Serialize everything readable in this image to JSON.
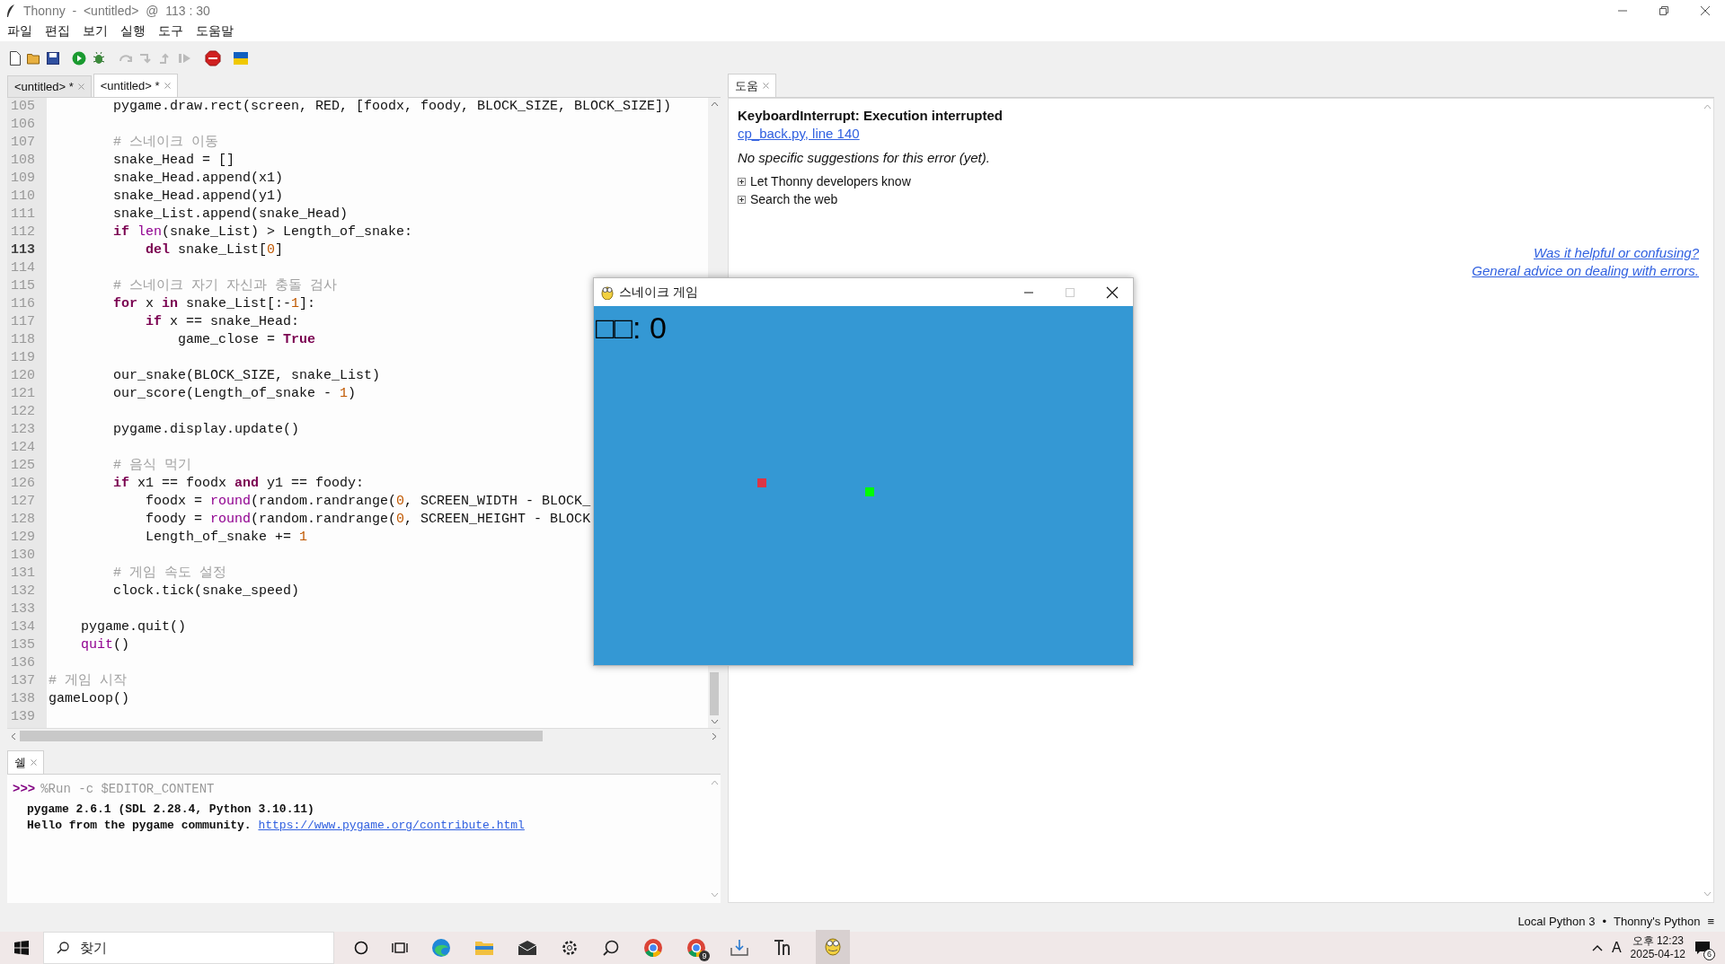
{
  "window": {
    "title": "Thonny  -  <untitled>  @  113 : 30"
  },
  "menu": [
    "파일",
    "편집",
    "보기",
    "실행",
    "도구",
    "도움말"
  ],
  "editor_tabs": [
    {
      "label": "<untitled> *",
      "selected": false
    },
    {
      "label": "<untitled> *",
      "selected": true
    }
  ],
  "editor": {
    "lines": [
      {
        "number": "105",
        "current": false,
        "tokens": [
          {
            "kind": "plain",
            "text": "        pygame.draw.rect(screen, RED, [foodx, foody, BLOCK_SIZE, BLOCK_SIZE])"
          }
        ]
      },
      {
        "number": "106",
        "current": false
      },
      {
        "number": "107",
        "current": false,
        "tokens": [
          {
            "kind": "comment",
            "text": "        # 스네이크 이동"
          }
        ]
      },
      {
        "number": "108",
        "current": false,
        "tokens": [
          {
            "kind": "plain",
            "text": "        snake_Head = []"
          }
        ]
      },
      {
        "number": "109",
        "current": false,
        "tokens": [
          {
            "kind": "plain",
            "text": "        snake_Head.append(x1)"
          }
        ]
      },
      {
        "number": "110",
        "current": false,
        "tokens": [
          {
            "kind": "plain",
            "text": "        snake_Head.append(y1)"
          }
        ]
      },
      {
        "number": "111",
        "current": false,
        "tokens": [
          {
            "kind": "plain",
            "text": "        snake_List.append(snake_Head)"
          }
        ]
      },
      {
        "number": "112",
        "current": false,
        "tokens": [
          {
            "kind": "keyword",
            "text": "        if "
          },
          {
            "kind": "builtin",
            "text": "len"
          },
          {
            "kind": "plain",
            "text": "(snake_List) > Length_of_snake:"
          }
        ]
      },
      {
        "number": "113",
        "current": true,
        "tokens": [
          {
            "kind": "keyword",
            "text": "            del"
          },
          {
            "kind": "plain",
            "text": " snake_List["
          },
          {
            "kind": "number",
            "text": "0"
          },
          {
            "kind": "plain",
            "text": "]"
          }
        ]
      },
      {
        "number": "114",
        "current": false
      },
      {
        "number": "115",
        "current": false,
        "tokens": [
          {
            "kind": "comment",
            "text": "        # 스네이크 자기 자신과 충돌 검사"
          }
        ]
      },
      {
        "number": "116",
        "current": false,
        "tokens": [
          {
            "kind": "keyword",
            "text": "        for"
          },
          {
            "kind": "plain",
            "text": " x "
          },
          {
            "kind": "keyword",
            "text": "in"
          },
          {
            "kind": "plain",
            "text": " snake_List[:-"
          },
          {
            "kind": "number",
            "text": "1"
          },
          {
            "kind": "plain",
            "text": "]:"
          }
        ]
      },
      {
        "number": "117",
        "current": false,
        "tokens": [
          {
            "kind": "keyword",
            "text": "            if"
          },
          {
            "kind": "plain",
            "text": " x == snake_Head:"
          }
        ]
      },
      {
        "number": "118",
        "current": false,
        "tokens": [
          {
            "kind": "plain",
            "text": "                game_close = "
          },
          {
            "kind": "keyword",
            "text": "True"
          }
        ]
      },
      {
        "number": "119",
        "current": false
      },
      {
        "number": "120",
        "current": false,
        "tokens": [
          {
            "kind": "plain",
            "text": "        our_snake(BLOCK_SIZE, snake_List)"
          }
        ]
      },
      {
        "number": "121",
        "current": false,
        "tokens": [
          {
            "kind": "plain",
            "text": "        our_score(Length_of_snake - "
          },
          {
            "kind": "number",
            "text": "1"
          },
          {
            "kind": "plain",
            "text": ")"
          }
        ]
      },
      {
        "number": "122",
        "current": false
      },
      {
        "number": "123",
        "current": false,
        "tokens": [
          {
            "kind": "plain",
            "text": "        pygame.display.update()"
          }
        ]
      },
      {
        "number": "124",
        "current": false
      },
      {
        "number": "125",
        "current": false,
        "tokens": [
          {
            "kind": "comment",
            "text": "        # 음식 먹기"
          }
        ]
      },
      {
        "number": "126",
        "current": false,
        "tokens": [
          {
            "kind": "keyword",
            "text": "        if"
          },
          {
            "kind": "plain",
            "text": " x1 == foodx "
          },
          {
            "kind": "keyword",
            "text": "and"
          },
          {
            "kind": "plain",
            "text": " y1 == foody:"
          }
        ]
      },
      {
        "number": "127",
        "current": false,
        "tokens": [
          {
            "kind": "plain",
            "text": "            foodx = "
          },
          {
            "kind": "builtin",
            "text": "round"
          },
          {
            "kind": "plain",
            "text": "(random.randrange("
          },
          {
            "kind": "number",
            "text": "0"
          },
          {
            "kind": "plain",
            "text": ", SCREEN_WIDTH - BLOCK_"
          }
        ]
      },
      {
        "number": "128",
        "current": false,
        "tokens": [
          {
            "kind": "plain",
            "text": "            foody = "
          },
          {
            "kind": "builtin",
            "text": "round"
          },
          {
            "kind": "plain",
            "text": "(random.randrange("
          },
          {
            "kind": "number",
            "text": "0"
          },
          {
            "kind": "plain",
            "text": ", SCREEN_HEIGHT - BLOCK"
          }
        ]
      },
      {
        "number": "129",
        "current": false,
        "tokens": [
          {
            "kind": "plain",
            "text": "            Length_of_snake += "
          },
          {
            "kind": "number",
            "text": "1"
          }
        ]
      },
      {
        "number": "130",
        "current": false
      },
      {
        "number": "131",
        "current": false,
        "tokens": [
          {
            "kind": "comment",
            "text": "        # 게임 속도 설정"
          }
        ]
      },
      {
        "number": "132",
        "current": false,
        "tokens": [
          {
            "kind": "plain",
            "text": "        clock.tick(snake_speed)"
          }
        ]
      },
      {
        "number": "133",
        "current": false
      },
      {
        "number": "134",
        "current": false,
        "tokens": [
          {
            "kind": "plain",
            "text": "    pygame.quit()"
          }
        ]
      },
      {
        "number": "135",
        "current": false,
        "tokens": [
          {
            "kind": "builtin",
            "text": "    quit"
          },
          {
            "kind": "plain",
            "text": "()"
          }
        ]
      },
      {
        "number": "136",
        "current": false
      },
      {
        "number": "137",
        "current": false,
        "tokens": [
          {
            "kind": "comment",
            "text": "# 게임 시작"
          }
        ]
      },
      {
        "number": "138",
        "current": false,
        "tokens": [
          {
            "kind": "plain",
            "text": "gameLoop()"
          }
        ]
      },
      {
        "number": "139",
        "current": false
      }
    ]
  },
  "shell": {
    "tab": "쉘",
    "prompt": ">>>",
    "command": "%Run -c $EDITOR_CONTENT",
    "output": [
      "pygame 2.6.1 (SDL 2.28.4, Python 3.10.11)",
      "Hello from the pygame community. "
    ],
    "link": "https://www.pygame.org/contribute.html"
  },
  "help": {
    "tab": "도움",
    "error": "KeyboardInterrupt: Execution interrupted",
    "location_link": "cp_back.py, line 140",
    "note": "No specific suggestions for this error (yet).",
    "sections": [
      {
        "label": "Let Thonny developers know",
        "expanded": false
      },
      {
        "label": "Search the web",
        "expanded": false
      }
    ],
    "feedback_links": [
      "Was it helpful or confusing?",
      "General advice on dealing with errors."
    ]
  },
  "game_window": {
    "title": "스네이크 게임",
    "score": "□□: 0"
  },
  "status_bar": {
    "interpreter": "Local Python 3",
    "separator": "•",
    "python": "Thonny's Python",
    "menu": "≡"
  },
  "taskbar": {
    "search_placeholder": "찾기",
    "chrome_badge": "9",
    "ime": "A",
    "time": "오후 12:23",
    "date": "2025-04-12",
    "notifications": "6"
  }
}
